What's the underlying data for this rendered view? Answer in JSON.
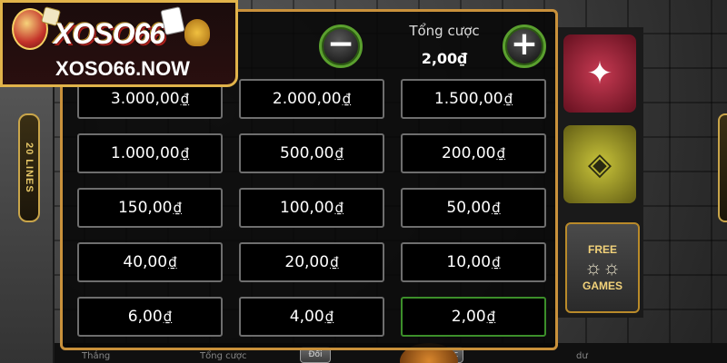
{
  "logo": {
    "name": "XOSO66",
    "url": "XOSO66.NOW"
  },
  "side_badge": {
    "text": "20 LINES"
  },
  "free_games_symbol": {
    "line1": "FREE",
    "line2": "GAMES"
  },
  "bet_panel": {
    "total_label": "Tổng cược",
    "total_value": "2,00₫",
    "minus_label": "−",
    "plus_label": "+",
    "currency_symbol": "₫",
    "selected_option": "2,00",
    "options": [
      "3.000,00",
      "2.000,00",
      "1.500,00",
      "1.000,00",
      "500,00",
      "200,00",
      "150,00",
      "100,00",
      "50,00",
      "40,00",
      "20,00",
      "10,00",
      "6,00",
      "4,00",
      "2,00"
    ]
  },
  "bottom_bar": {
    "left_label": "Thắng",
    "bet_label": "Tổng cược",
    "btn_left": "Đổi",
    "btn_right": "Cược",
    "right_label": "dư"
  },
  "colors": {
    "panel_border": "#c9913b",
    "round_button_ring": "#5aa02e",
    "selected_border": "#3c8f2a",
    "logo_border": "#e1b34a"
  },
  "icons": {
    "minus": "minus-icon",
    "plus": "plus-icon",
    "reel_symbol_1": "aztec-bird-icon",
    "reel_symbol_2": "aztec-serpent-icon"
  }
}
